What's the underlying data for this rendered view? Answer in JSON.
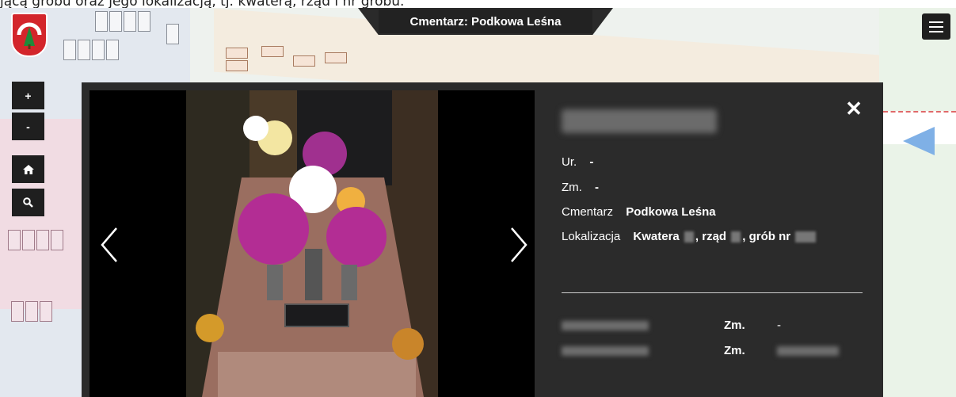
{
  "caption": "jącą grobu oraz jego lokalizacją, tj. kwaterą, rząd i nr grobu.",
  "header": {
    "cemetery_title": "Cmentarz: Podkowa Leśna"
  },
  "map_controls": {
    "zoom_in": "+",
    "zoom_out": "-",
    "home_icon": "home-icon",
    "search_icon": "search-icon"
  },
  "menu": {
    "icon": "hamburger-icon"
  },
  "modal": {
    "close_label": "✕",
    "person": {
      "born_label": "Ur.",
      "born_value": "-",
      "died_label": "Zm.",
      "died_value": "-",
      "cemetery_label": "Cmentarz",
      "cemetery_value": "Podkowa Leśna",
      "location_label": "Lokalizacja",
      "loc_kwatera": "Kwatera",
      "loc_rzad": ", rząd",
      "loc_grob": ", grób nr"
    },
    "related": [
      {
        "zm_label": "Zm.",
        "zm_value": "-"
      },
      {
        "zm_label": "Zm.",
        "zm_value": ""
      }
    ]
  },
  "colors": {
    "modal_bg": "#2b2b2b",
    "logo_red": "#d3252b",
    "control_bg": "#1f1f1f"
  }
}
